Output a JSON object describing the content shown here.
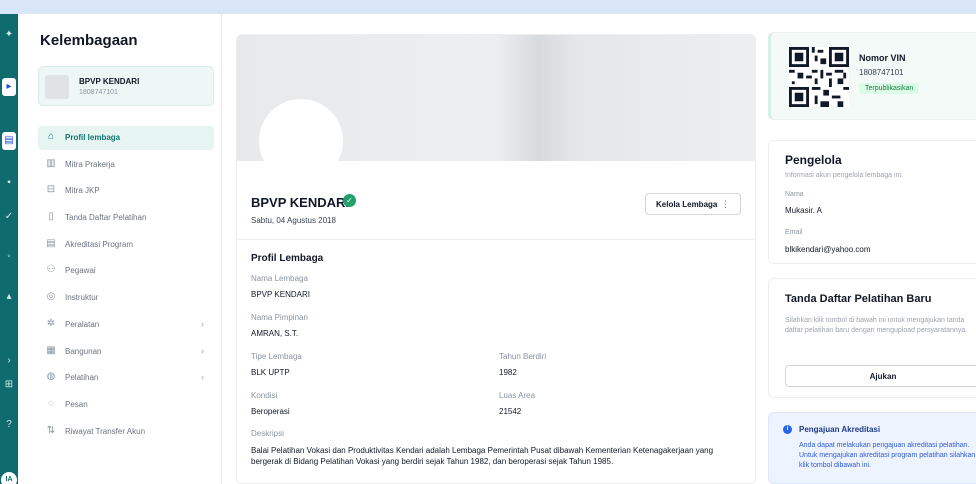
{
  "sidebar": {
    "title": "Kelembagaan",
    "org": {
      "name": "BPVP KENDARI",
      "id": "1808747101"
    },
    "items": [
      {
        "label": "Profil lembaga",
        "icon": "home-icon",
        "active": true
      },
      {
        "label": "Mitra Prakerja",
        "icon": "building-icon"
      },
      {
        "label": "Mitra JKP",
        "icon": "inbox-icon"
      },
      {
        "label": "Tanda Daftar Pelatihan",
        "icon": "document-icon"
      },
      {
        "label": "Akreditasi Program",
        "icon": "file-text-icon"
      },
      {
        "label": "Pegawai",
        "icon": "users-icon"
      },
      {
        "label": "Instruktur",
        "icon": "instructor-icon"
      },
      {
        "label": "Peralatan",
        "icon": "tools-icon",
        "chevron": "›"
      },
      {
        "label": "Bangunan",
        "icon": "building-icon",
        "chevron": "›"
      },
      {
        "label": "Pelatihan",
        "icon": "globe-icon",
        "chevron": "›"
      },
      {
        "label": "Pesan",
        "icon": "chat-icon"
      },
      {
        "label": "Riwayat Transfer Akun",
        "icon": "transfer-icon"
      }
    ]
  },
  "rail": {
    "avatar": "IA"
  },
  "main": {
    "org_name": "BPVP KENDARI",
    "date": "Sabtu, 04 Agustus 2018",
    "kelola_label": "Kelola Lembaga",
    "kelola_more": "⋮",
    "profil_title": "Profil Lembaga",
    "fields": {
      "nama_label": "Nama Lembaga",
      "nama_value": "BPVP KENDARI",
      "pimpinan_label": "Nama Pimpinan",
      "pimpinan_value": "AMRAN, S.T.",
      "tipe_label": "Tipe Lembaga",
      "tipe_value": "BLK UPTP",
      "tahun_label": "Tahun Berdiri",
      "tahun_value": "1982",
      "kondisi_label": "Kondisi",
      "kondisi_value": "Beroperasi",
      "luas_label": "Luas Area",
      "luas_value": "21542",
      "deskripsi_label": "Deskripsi",
      "deskripsi_value": "Balai Pelatihan Vokasi dan Produktivitas Kendari adalah Lembaga Pemerintah Pusat dibawah Kementerian Ketenagakerjaan yang bergerak di Bidang Pelatihan Vokasi yang berdiri sejak Tahun 1982, dan beroperasi sejak Tahun 1985."
    }
  },
  "vin": {
    "label": "Nomor VIN",
    "number": "1808747101",
    "status": "Terpublikasikan"
  },
  "pengelola": {
    "title": "Pengelola",
    "subtitle": "Informasi akun pengelola lembaga ini.",
    "nama_label": "Nama",
    "nama_value": "Mukasir. A",
    "email_label": "Email",
    "email_value": "blkikendari@yahoo.com"
  },
  "tdp": {
    "title": "Tanda Daftar Pelatihan Baru",
    "desc": "Silahkan klik tombol di bawah ini untuk mengajukan tanda daftar pelatihan baru dengan mengupload persyaratannya.",
    "button": "Ajukan"
  },
  "akreditasi": {
    "title": "Pengajuan Akreditasi",
    "desc": "Anda dapat melakukan pengajuan akreditasi pelatihan. Untuk mengajukan akreditasi program pelatihan silahkan klik tombol dibawah ini."
  },
  "colors": {
    "accent": "#0f766e",
    "rail": "#0f6b6e",
    "success": "#22a06b",
    "info": "#2563eb"
  }
}
